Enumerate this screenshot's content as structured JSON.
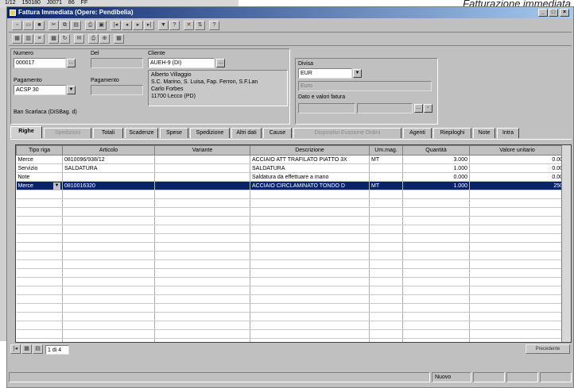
{
  "background": {
    "strip_cells": [
      "1/12",
      "150180",
      "J0071",
      "86",
      "FF"
    ],
    "caption": "Fatturazione immediata"
  },
  "window": {
    "title": "Fattura Immediata (Opere: Pendibelia)",
    "controls": [
      "_",
      "□",
      "×"
    ]
  },
  "toolbar1": {
    "icons": [
      "new-icon",
      "open-icon",
      "save-icon",
      "cut-icon",
      "copy-icon",
      "paste-icon",
      "print-icon",
      "preview-icon",
      "first-icon",
      "prev-icon",
      "next-icon",
      "last-icon",
      "filter-icon",
      "find-icon",
      "delete-icon",
      "sort-icon",
      "help-icon"
    ]
  },
  "toolbar2": {
    "icons": [
      "grid-icon",
      "calc-icon",
      "list-icon",
      "attach-icon",
      "refresh-icon",
      "mail-icon",
      "printer-icon",
      "zoom-icon",
      "calendar-icon"
    ]
  },
  "header": {
    "numero_label": "Numero",
    "numero_value": "000017",
    "del_label": "Del",
    "del_value": "",
    "cliente_label": "Cliente",
    "cliente_value": "AUEH-9 (DI)",
    "cliente_address": [
      "Alberto Villaggio",
      "S.C. Marino, S. Luisa, Fap. Ferron, S.F.Lan",
      "Carlo Forbes",
      "11700 Lecco (PD)"
    ],
    "pagamento_label": "Pagamento",
    "pagamento_value": "ACSP 30",
    "pagamento_alt_label": "Pagamento",
    "pagamento_alt_value": "",
    "banca_line": "Ban Scarlaca (DiSBag. d)",
    "divisa_label": "Divisa",
    "divisa_value": "EUR",
    "divisa_desc": "Euro",
    "dato_label": "Dato e valori fatura"
  },
  "tabs": [
    {
      "label": "Righe",
      "state": "active"
    },
    {
      "label": "Spedizioni",
      "state": "disabled"
    },
    {
      "label": "Totali",
      "state": "normal"
    },
    {
      "label": "Scadenze",
      "state": "normal"
    },
    {
      "label": "Spese",
      "state": "normal"
    },
    {
      "label": "Spedizione",
      "state": "normal"
    },
    {
      "label": "Altri dati",
      "state": "normal"
    },
    {
      "label": "Cause",
      "state": "normal"
    },
    {
      "label": "Dispositivi Evasione Ordini",
      "state": "disabled"
    },
    {
      "label": "Agenti",
      "state": "normal"
    },
    {
      "label": "Riepiloghi",
      "state": "normal"
    },
    {
      "label": "Note",
      "state": "normal"
    },
    {
      "label": "Intra",
      "state": "normal"
    }
  ],
  "grid": {
    "columns": [
      "Tipo riga",
      "Articolo",
      "Variante",
      "Descrizione",
      "Um.mag.",
      "Quantità",
      "Valore unitario"
    ],
    "rows": [
      {
        "tipo": "Merce",
        "articolo": "0810096/938/12",
        "variante": "",
        "descrizione": "ACCIAIO ATT TRAFILATO PIATTO 3X",
        "um": "MT",
        "quantita": "3.000",
        "valore": "0.00",
        "selected": false
      },
      {
        "tipo": "Servizio",
        "articolo": "SALDATURA",
        "variante": "",
        "descrizione": "SALDATURA",
        "um": "",
        "quantita": "1.000",
        "valore": "0.00",
        "selected": false
      },
      {
        "tipo": "Note",
        "articolo": "",
        "variante": "",
        "descrizione": "Saldatura da effettuare a mano",
        "um": "",
        "quantita": "0.000",
        "valore": "0.00",
        "selected": false
      },
      {
        "tipo": "Merce",
        "articolo": "0810016320",
        "variante": "",
        "descrizione": "ACCIAIO CIRCLAMINATO TONDO D",
        "um": "MT",
        "quantita": "1.000",
        "valore": "250",
        "selected": true
      }
    ],
    "empty_rows": 18
  },
  "bottom": {
    "nav_label": "1 di 4",
    "right_label": "Precedente"
  },
  "status": {
    "mode": "Nuovo"
  },
  "colors": {
    "title_start": "#0a246a",
    "title_end": "#a6caf0",
    "selection": "#0a246a",
    "face": "#c0c0c0"
  }
}
